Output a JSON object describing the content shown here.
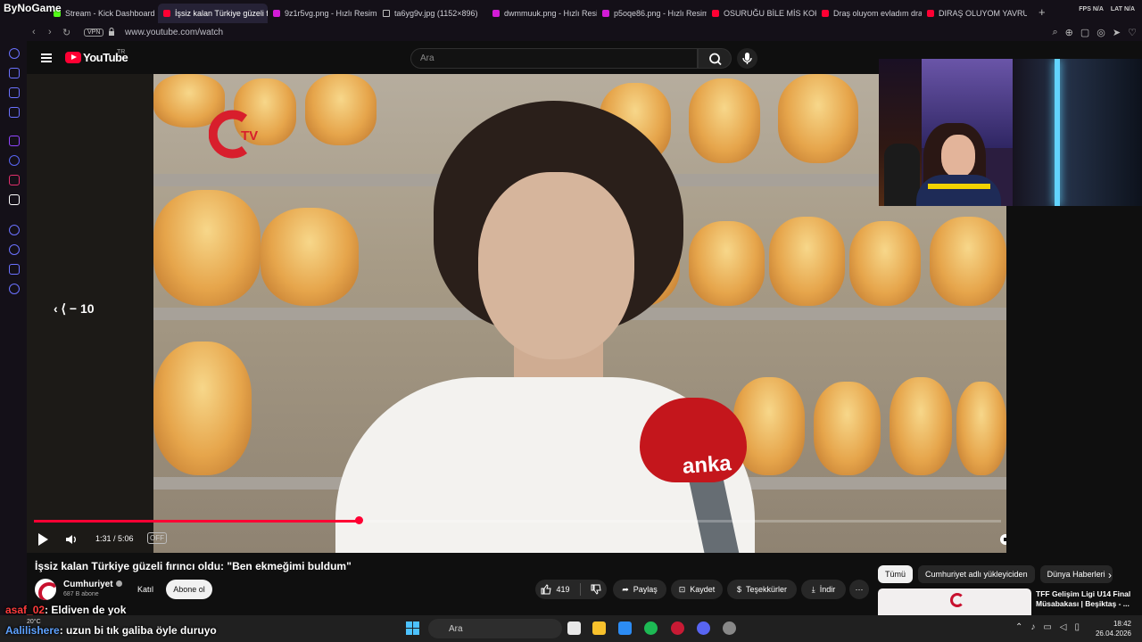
{
  "stream_brand": "ByNoGame",
  "tabs": [
    {
      "label": "Stream - Kick Dashboard",
      "favicon": "kick"
    },
    {
      "label": "İşsiz kalan Türkiye güzeli f",
      "favicon": "yt",
      "active": true
    },
    {
      "label": "9z1r5vg.png - Hızlı Resim",
      "favicon": "img"
    },
    {
      "label": "ta6yg9v.jpg (1152×896)",
      "favicon": "doc"
    },
    {
      "label": "dwmmuuk.png - Hızlı Resim",
      "favicon": "img"
    },
    {
      "label": "p5oqe86.png - Hızlı Resim",
      "favicon": "img"
    },
    {
      "label": "OSURUĞU BİLE MİS KOKU",
      "favicon": "yt"
    },
    {
      "label": "Draş oluyom evladım dra",
      "favicon": "yt"
    },
    {
      "label": "DIRAŞ OLUYOM YAVRUM",
      "favicon": "yt"
    }
  ],
  "window_stats": {
    "fps": "FPS N/A",
    "lat": "LAT N/A"
  },
  "address": {
    "vpn": "VPN",
    "url": "www.youtube.com/watch"
  },
  "youtube": {
    "logo": "YouTube",
    "country": "TR",
    "search_placeholder": "Ara"
  },
  "video": {
    "seek_label": "‹ ⟨ − 10",
    "channel_bug": "TV",
    "watermark": "anka",
    "mic_brand": "anka",
    "time": "1:31 / 5:06",
    "cc_label": "OFF",
    "progress": 0.3357,
    "title": "İşsiz kalan Türkiye güzeli fırıncı oldu: \"Ben ekmeğimi buldum\""
  },
  "channel": {
    "name": "Cumhuriyet",
    "subs": "687 B abone",
    "join": "Katıl",
    "subscribe": "Abone ol"
  },
  "actions": {
    "likes": "419",
    "share": "Paylaş",
    "save": "Kaydet",
    "thanks": "Teşekkürler",
    "download": "İndir"
  },
  "chips": [
    "Tümü",
    "Cumhuriyet adlı yükleyiciden",
    "Dünya Haberleri"
  ],
  "recommended": {
    "title": "TFF Gelişim Ligi U14 Final Müsabakası | Beşiktaş - ..."
  },
  "chat": [
    {
      "user": "asaf_02",
      "message": ": Eldiven de yok"
    },
    {
      "user": "Aalilishere",
      "message": ": uzun bi tık galiba öyle duruyo"
    }
  ],
  "taskbar": {
    "weather": "20°C",
    "search": "Ara",
    "time": "18:42",
    "date": "26.04.2026"
  },
  "colors": {
    "youtube_red": "#ff0033",
    "opera_accent": "#6b72ff"
  }
}
